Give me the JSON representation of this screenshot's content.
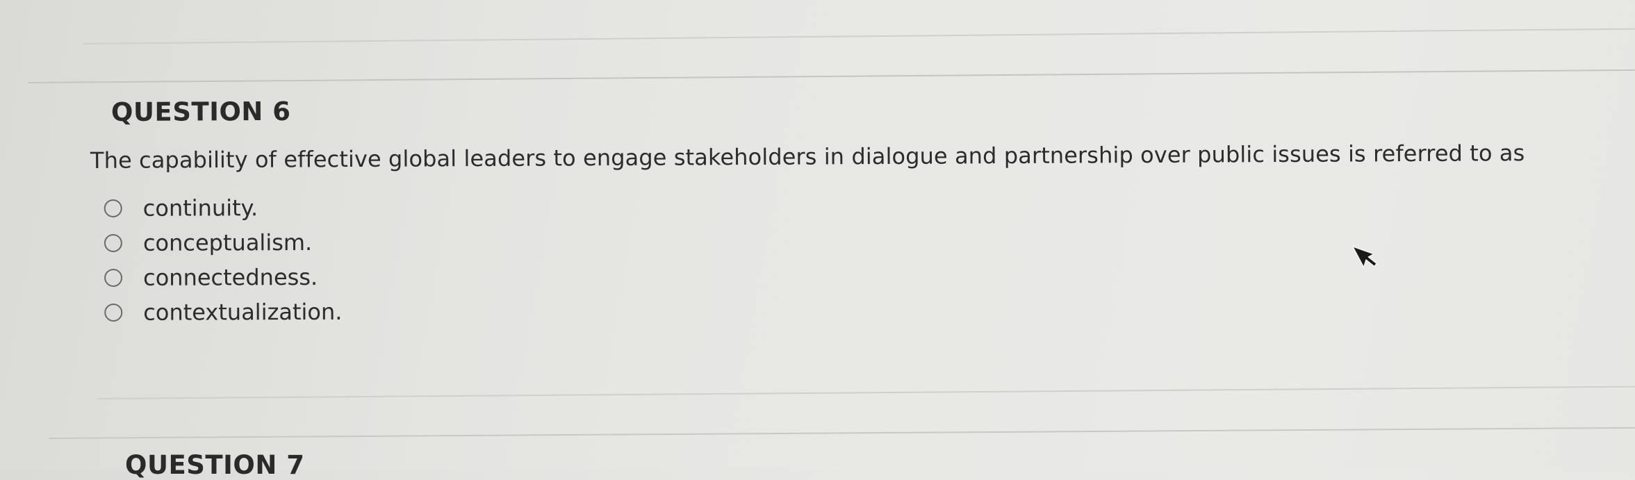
{
  "question": {
    "heading": "QUESTION 6",
    "text": "The capability of effective global leaders to engage stakeholders in dialogue and partnership over public issues is referred to as",
    "options": [
      {
        "label": "continuity."
      },
      {
        "label": "conceptualism."
      },
      {
        "label": "connectedness."
      },
      {
        "label": "contextualization."
      }
    ]
  },
  "next_question": {
    "heading": "QUESTION 7"
  },
  "icons": {
    "radio": "radio-button-unselected",
    "cursor": "mouse-pointer"
  }
}
